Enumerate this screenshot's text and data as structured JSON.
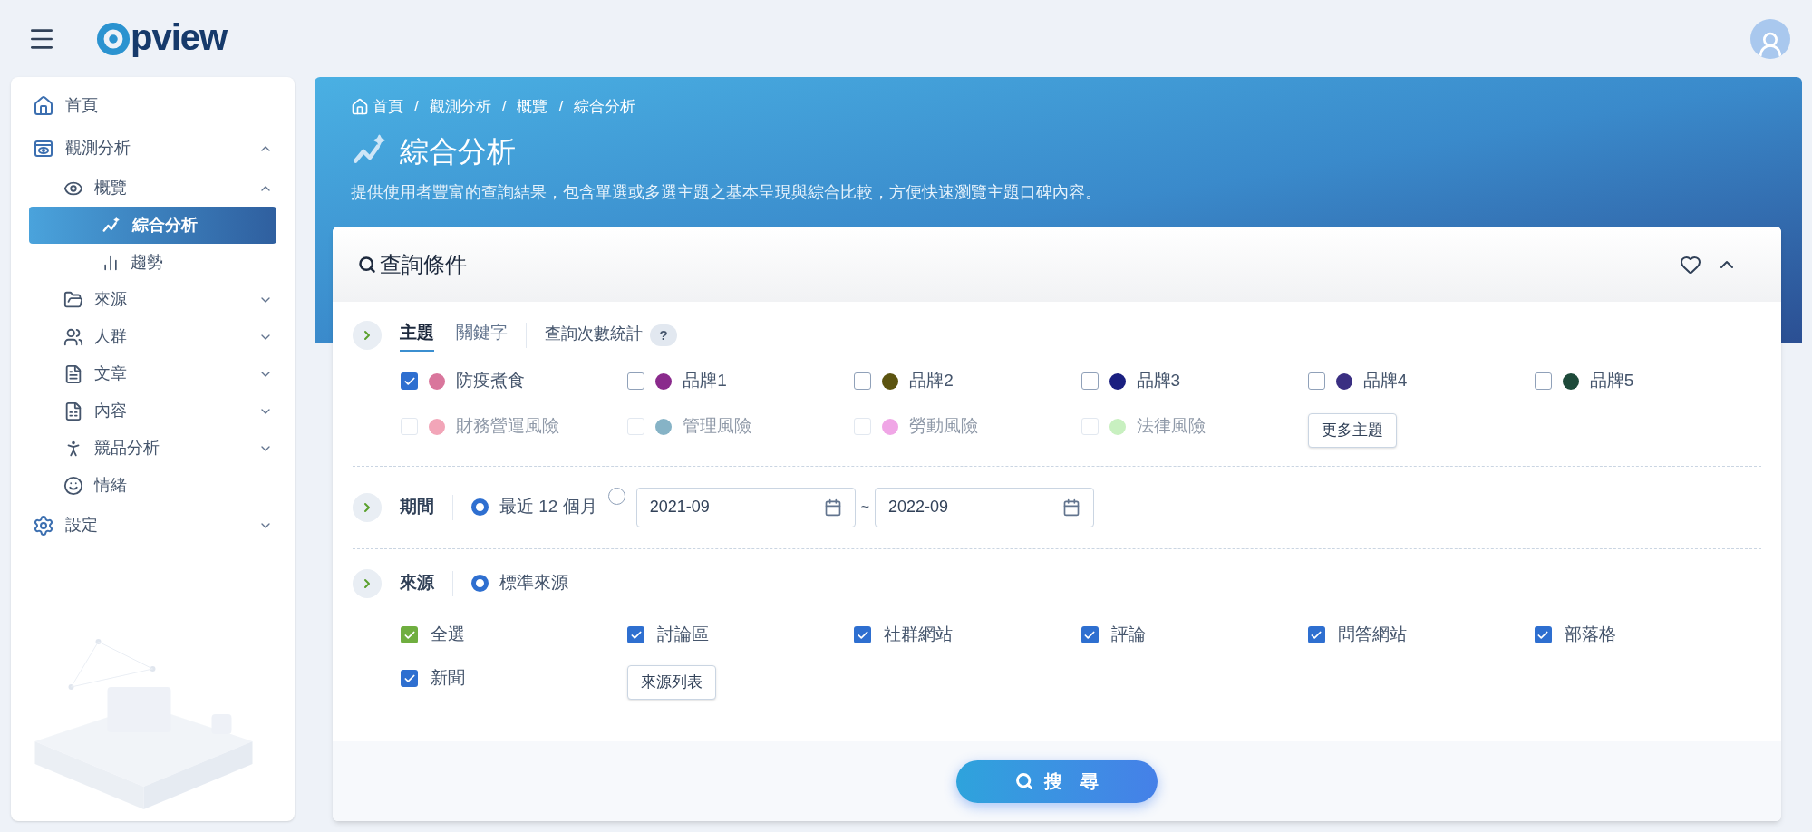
{
  "header": {
    "logo": "pview"
  },
  "sidebar": {
    "items": [
      {
        "label": "首頁",
        "selected": false
      },
      {
        "label": "觀測分析",
        "expanded": true,
        "selected": false,
        "children": [
          {
            "label": "概覽",
            "expanded": true,
            "selected": false,
            "children": [
              {
                "label": "綜合分析",
                "selected": true
              },
              {
                "label": "趨勢",
                "selected": false
              }
            ]
          },
          {
            "label": "來源",
            "expanded": false,
            "selected": false
          },
          {
            "label": "人群",
            "expanded": false,
            "selected": false
          },
          {
            "label": "文章",
            "expanded": false,
            "selected": false
          },
          {
            "label": "內容",
            "expanded": false,
            "selected": false
          },
          {
            "label": "競品分析",
            "expanded": false,
            "selected": false
          },
          {
            "label": "情緒",
            "selected": false
          }
        ]
      },
      {
        "label": "設定",
        "expanded": false,
        "selected": false
      }
    ]
  },
  "banner": {
    "breadcrumb": [
      "首頁",
      "觀測分析",
      "概覽",
      "綜合分析"
    ],
    "breadcrumb_separator": "/",
    "title": "綜合分析",
    "description": "提供使用者豐富的查詢結果，包含單選或多選主題之基本呈現與綜合比較，方便快速瀏覽主題口碑內容。"
  },
  "query_panel": {
    "title": "查詢條件",
    "tabs": [
      {
        "label": "主題",
        "selected": true
      },
      {
        "label": "關鍵字",
        "selected": false
      }
    ],
    "stats_link": "查詢次數統計",
    "help_badge": "?",
    "topics": [
      {
        "label": "防疫煮食",
        "checked": true,
        "disabled": false,
        "color": "#d9769c"
      },
      {
        "label": "品牌1",
        "checked": false,
        "disabled": false,
        "color": "#8a2a8c"
      },
      {
        "label": "品牌2",
        "checked": false,
        "disabled": false,
        "color": "#5c5410"
      },
      {
        "label": "品牌3",
        "checked": false,
        "disabled": false,
        "color": "#1a1f80"
      },
      {
        "label": "品牌4",
        "checked": false,
        "disabled": false,
        "color": "#3a2f82"
      },
      {
        "label": "品牌5",
        "checked": false,
        "disabled": false,
        "color": "#1e4a3a"
      },
      {
        "label": "財務營運風險",
        "checked": false,
        "disabled": true,
        "color": "#f2a5b8"
      },
      {
        "label": "管理風險",
        "checked": false,
        "disabled": true,
        "color": "#86b3c6"
      },
      {
        "label": "勞動風險",
        "checked": false,
        "disabled": true,
        "color": "#f0a6e6"
      },
      {
        "label": "法律風險",
        "checked": false,
        "disabled": true,
        "color": "#c8f0c0"
      }
    ],
    "more_topics_button": "更多主題",
    "period": {
      "label": "期間",
      "options": [
        {
          "label": "最近 12 個月",
          "selected": true
        },
        {
          "kind": "range",
          "selected": false,
          "from": "2021-09",
          "separator": "~",
          "to": "2022-09"
        }
      ]
    },
    "source": {
      "label": "來源",
      "options": [
        {
          "label": "標準來源",
          "selected": true
        }
      ],
      "checks": [
        {
          "label": "全選",
          "checked": true,
          "kind": "all"
        },
        {
          "label": "討論區",
          "checked": true,
          "kind": "item"
        },
        {
          "label": "社群網站",
          "checked": true,
          "kind": "item"
        },
        {
          "label": "評論",
          "checked": true,
          "kind": "item"
        },
        {
          "label": "問答網站",
          "checked": true,
          "kind": "item"
        },
        {
          "label": "部落格",
          "checked": true,
          "kind": "item"
        },
        {
          "label": "新聞",
          "checked": true,
          "kind": "item"
        }
      ],
      "list_button": "來源列表"
    },
    "search_button": "搜　尋"
  }
}
